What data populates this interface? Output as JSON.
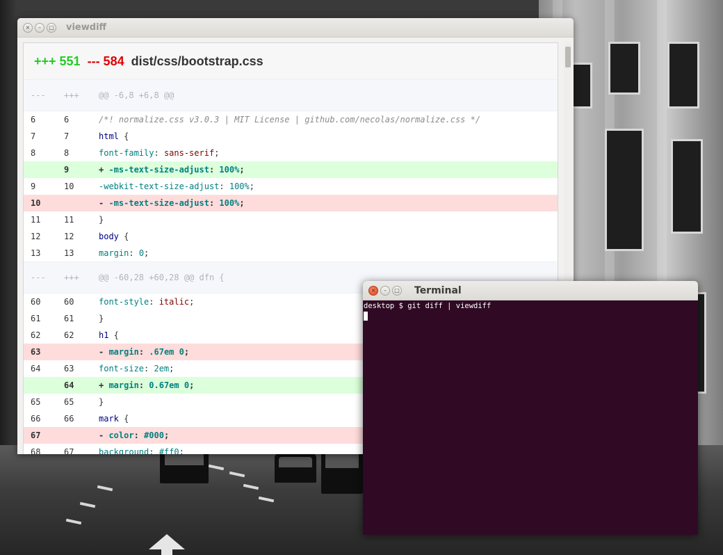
{
  "viewdiff": {
    "title": "viewdiff",
    "additions": "+++ 551",
    "deletions": "--- 584",
    "filename": "dist/css/bootstrap.css",
    "hunks": [
      {
        "header": {
          "old": "---",
          "new": "+++",
          "text": "@@ -6,8 +6,8 @@"
        },
        "lines": [
          {
            "old": "6",
            "new": "6",
            "type": "ctx",
            "tokens": [
              {
                "t": "/*! normalize.css v3.0.3 | MIT License | github.com/necolas/normalize.css */",
                "c": "cmt"
              }
            ]
          },
          {
            "old": "7",
            "new": "7",
            "type": "ctx",
            "tokens": [
              {
                "t": "html",
                "c": "sel"
              },
              {
                "t": " {",
                "c": "plain"
              }
            ]
          },
          {
            "old": "8",
            "new": "8",
            "type": "ctx",
            "tokens": [
              {
                "t": "font-family",
                "c": "prop"
              },
              {
                "t": ": ",
                "c": "plain"
              },
              {
                "t": "sans-serif",
                "c": "val"
              },
              {
                "t": ";",
                "c": "plain"
              }
            ]
          },
          {
            "old": "",
            "new": "9",
            "type": "add",
            "tokens": [
              {
                "t": "+ ",
                "c": "plain"
              },
              {
                "t": "-ms-text-size-adjust",
                "c": "prop"
              },
              {
                "t": ": ",
                "c": "plain"
              },
              {
                "t": "100%",
                "c": "num"
              },
              {
                "t": ";",
                "c": "plain"
              }
            ]
          },
          {
            "old": "9",
            "new": "10",
            "type": "ctx",
            "tokens": [
              {
                "t": "-webkit-text-size-adjust",
                "c": "prop"
              },
              {
                "t": ": ",
                "c": "plain"
              },
              {
                "t": "100%",
                "c": "num"
              },
              {
                "t": ";",
                "c": "plain"
              }
            ]
          },
          {
            "old": "10",
            "new": "",
            "type": "del",
            "tokens": [
              {
                "t": "- ",
                "c": "plain"
              },
              {
                "t": "-ms-text-size-adjust",
                "c": "prop"
              },
              {
                "t": ": ",
                "c": "plain"
              },
              {
                "t": "100%",
                "c": "num"
              },
              {
                "t": ";",
                "c": "plain"
              }
            ]
          },
          {
            "old": "11",
            "new": "11",
            "type": "ctx",
            "tokens": [
              {
                "t": "}",
                "c": "plain"
              }
            ]
          },
          {
            "old": "12",
            "new": "12",
            "type": "ctx",
            "tokens": [
              {
                "t": "body",
                "c": "sel"
              },
              {
                "t": " {",
                "c": "plain"
              }
            ]
          },
          {
            "old": "13",
            "new": "13",
            "type": "ctx",
            "tokens": [
              {
                "t": "margin",
                "c": "prop"
              },
              {
                "t": ": ",
                "c": "plain"
              },
              {
                "t": "0",
                "c": "num"
              },
              {
                "t": ";",
                "c": "plain"
              }
            ]
          }
        ]
      },
      {
        "header": {
          "old": "---",
          "new": "+++",
          "text": "@@ -60,28 +60,28 @@ dfn {"
        },
        "lines": [
          {
            "old": "60",
            "new": "60",
            "type": "ctx",
            "tokens": [
              {
                "t": "font-style",
                "c": "prop"
              },
              {
                "t": ": ",
                "c": "plain"
              },
              {
                "t": "italic",
                "c": "val"
              },
              {
                "t": ";",
                "c": "plain"
              }
            ]
          },
          {
            "old": "61",
            "new": "61",
            "type": "ctx",
            "tokens": [
              {
                "t": "}",
                "c": "plain"
              }
            ]
          },
          {
            "old": "62",
            "new": "62",
            "type": "ctx",
            "tokens": [
              {
                "t": "h1",
                "c": "sel"
              },
              {
                "t": " {",
                "c": "plain"
              }
            ]
          },
          {
            "old": "63",
            "new": "",
            "type": "del",
            "tokens": [
              {
                "t": "- ",
                "c": "plain"
              },
              {
                "t": "margin",
                "c": "prop"
              },
              {
                "t": ": ",
                "c": "plain"
              },
              {
                "t": ".67em 0",
                "c": "num"
              },
              {
                "t": ";",
                "c": "plain"
              }
            ]
          },
          {
            "old": "64",
            "new": "63",
            "type": "ctx",
            "tokens": [
              {
                "t": "font-size",
                "c": "prop"
              },
              {
                "t": ": ",
                "c": "plain"
              },
              {
                "t": "2em",
                "c": "num"
              },
              {
                "t": ";",
                "c": "plain"
              }
            ]
          },
          {
            "old": "",
            "new": "64",
            "type": "add",
            "tokens": [
              {
                "t": "+ ",
                "c": "plain"
              },
              {
                "t": "margin",
                "c": "prop"
              },
              {
                "t": ": ",
                "c": "plain"
              },
              {
                "t": "0.67em 0",
                "c": "num"
              },
              {
                "t": ";",
                "c": "plain"
              }
            ]
          },
          {
            "old": "65",
            "new": "65",
            "type": "ctx",
            "tokens": [
              {
                "t": "}",
                "c": "plain"
              }
            ]
          },
          {
            "old": "66",
            "new": "66",
            "type": "ctx",
            "tokens": [
              {
                "t": "mark",
                "c": "sel"
              },
              {
                "t": " {",
                "c": "plain"
              }
            ]
          },
          {
            "old": "67",
            "new": "",
            "type": "del",
            "tokens": [
              {
                "t": "- ",
                "c": "plain"
              },
              {
                "t": "color",
                "c": "prop"
              },
              {
                "t": ": ",
                "c": "plain"
              },
              {
                "t": "#000",
                "c": "num"
              },
              {
                "t": ";",
                "c": "plain"
              }
            ]
          },
          {
            "old": "68",
            "new": "67",
            "type": "ctx",
            "tokens": [
              {
                "t": "background",
                "c": "prop"
              },
              {
                "t": ": ",
                "c": "plain"
              },
              {
                "t": "#ff0",
                "c": "num"
              },
              {
                "t": ";",
                "c": "plain"
              }
            ]
          }
        ]
      }
    ]
  },
  "terminal": {
    "title": "Terminal",
    "prompt_line": "desktop $ git diff | viewdiff"
  },
  "window_controls": {
    "close": "×",
    "minimize": "–",
    "maximize": "□"
  },
  "colors": {
    "add_bg": "#dcffdc",
    "del_bg": "#ffdcdc",
    "additions_text": "#22cc22",
    "deletions_text": "#e00000",
    "terminal_bg": "#300a24"
  }
}
